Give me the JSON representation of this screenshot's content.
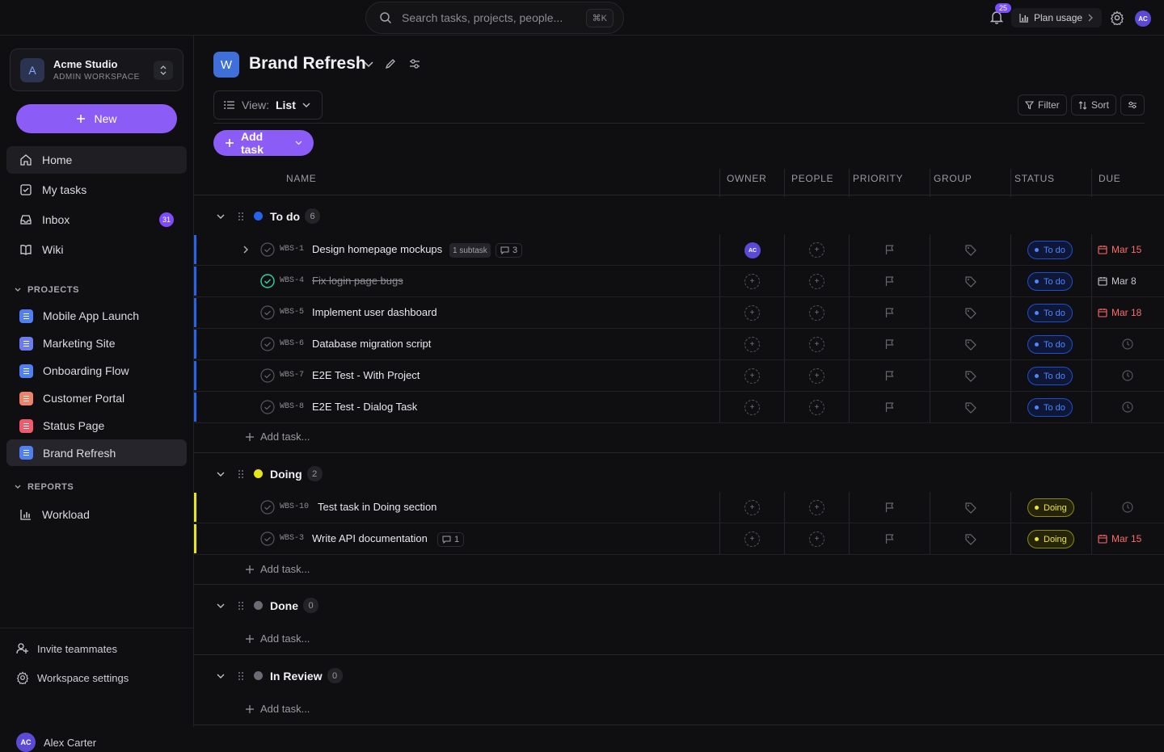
{
  "search": {
    "placeholder": "Search tasks, projects, people...",
    "shortcut": "⌘K"
  },
  "topbar": {
    "notifications": "25",
    "plan_usage": "Plan usage",
    "user_initials": "AC"
  },
  "workspace": {
    "initial": "A",
    "name": "Acme Studio",
    "role": "ADMIN WORKSPACE"
  },
  "sidebar": {
    "new_label": "New",
    "nav": [
      {
        "label": "Home",
        "icon": "home-icon"
      },
      {
        "label": "My tasks",
        "icon": "checkbox-icon"
      },
      {
        "label": "Inbox",
        "icon": "inbox-icon",
        "badge": "31"
      },
      {
        "label": "Wiki",
        "icon": "book-icon"
      }
    ],
    "projects_heading": "PROJECTS",
    "projects": [
      {
        "label": "Mobile App Launch",
        "color": "#4f7ff0"
      },
      {
        "label": "Marketing Site",
        "color": "#6a7cf0"
      },
      {
        "label": "Onboarding Flow",
        "color": "#4f7ff0"
      },
      {
        "label": "Customer Portal",
        "color": "#f0826a"
      },
      {
        "label": "Status Page",
        "color": "#f05a6a"
      },
      {
        "label": "Brand Refresh",
        "color": "#4f7ff0"
      }
    ],
    "reports_heading": "REPORTS",
    "reports": [
      {
        "label": "Workload"
      }
    ],
    "footer": {
      "invite": "Invite teammates",
      "settings": "Workspace settings",
      "user_name": "Alex Carter",
      "user_initials": "AC"
    }
  },
  "project": {
    "initial": "W",
    "title": "Brand Refresh",
    "view_prefix": "View:",
    "view_value": "List",
    "filter": "Filter",
    "sort": "Sort",
    "add_task": "Add task",
    "add_task_row": "Add task..."
  },
  "columns": [
    "NAME",
    "OWNER",
    "PEOPLE",
    "PRIORITY",
    "GROUP",
    "STATUS",
    "DUE"
  ],
  "groups": [
    {
      "name": "To do",
      "count": "6",
      "color": "#2563eb"
    },
    {
      "name": "Doing",
      "count": "2",
      "color": "#e5e51a"
    },
    {
      "name": "Done",
      "count": "0",
      "color": "#6b6b73"
    },
    {
      "name": "In Review",
      "count": "0",
      "color": "#6b6b73"
    }
  ],
  "tasks": {
    "todo": [
      {
        "id": "WBS-1",
        "name": "Design homepage mockups",
        "subtask": "1 subtask",
        "comments": "3",
        "owner": "AC",
        "status": "To do",
        "due": "Mar 15"
      },
      {
        "id": "WBS-4",
        "name": "Fix login page bugs",
        "status": "To do",
        "due": "Mar 8"
      },
      {
        "id": "WBS-5",
        "name": "Implement user dashboard",
        "status": "To do",
        "due": "Mar 18"
      },
      {
        "id": "WBS-6",
        "name": "Database migration script",
        "status": "To do"
      },
      {
        "id": "WBS-7",
        "name": "E2E Test - With Project",
        "status": "To do"
      },
      {
        "id": "WBS-8",
        "name": "E2E Test - Dialog Task",
        "status": "To do"
      }
    ],
    "doing": [
      {
        "id": "WBS-10",
        "name": "Test task in Doing section",
        "status": "Doing"
      },
      {
        "id": "WBS-3",
        "name": "Write API documentation",
        "comments": "1",
        "status": "Doing",
        "due": "Mar 15"
      }
    ]
  }
}
